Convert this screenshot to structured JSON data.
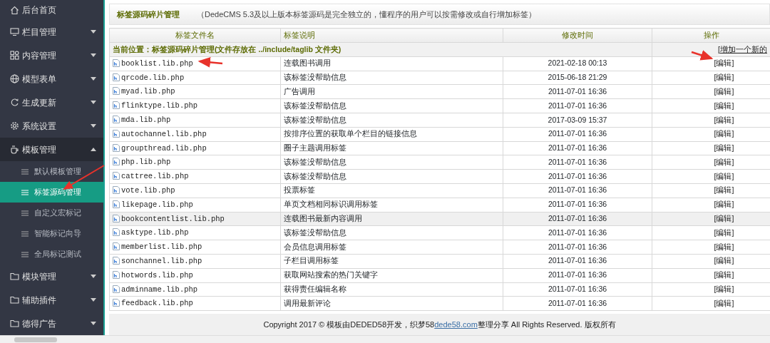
{
  "sidebar": {
    "items": [
      {
        "label": "后台首页",
        "kind": "link",
        "expanded": false
      },
      {
        "label": "栏目管理",
        "kind": "menu",
        "expanded": false
      },
      {
        "label": "内容管理",
        "kind": "menu",
        "expanded": false
      },
      {
        "label": "模型表单",
        "kind": "menu",
        "expanded": false
      },
      {
        "label": "生成更新",
        "kind": "menu",
        "expanded": false
      },
      {
        "label": "系统设置",
        "kind": "menu",
        "expanded": false
      },
      {
        "label": "模板管理",
        "kind": "menu",
        "expanded": true,
        "children": [
          {
            "label": "默认模板管理",
            "selected": false
          },
          {
            "label": "标签源码管理",
            "selected": true
          },
          {
            "label": "自定义宏标记",
            "selected": false
          },
          {
            "label": "智能标记向导",
            "selected": false
          },
          {
            "label": "全局标记测试",
            "selected": false
          }
        ]
      },
      {
        "label": "模块管理",
        "kind": "menu",
        "expanded": false
      },
      {
        "label": "辅助插件",
        "kind": "menu",
        "expanded": false
      },
      {
        "label": "德得广告",
        "kind": "menu",
        "expanded": false
      }
    ]
  },
  "page": {
    "title": "标签源码碎片管理",
    "note": "（DedeCMS 5.3及以上版本标签源码是完全独立的，懂程序的用户可以按需修改或自行增加标签）"
  },
  "table": {
    "columns": [
      "标签文件名",
      "标签说明",
      "修改时间",
      "操作"
    ],
    "location": "当前位置：标签源码碎片管理(文件存放在 ../include/taglib 文件夹)",
    "add_link": "[增加一个新的",
    "rows": [
      {
        "name": "booklist.lib.php",
        "description": "连载图书调用",
        "modified": "2021-02-18 00:13",
        "action": "[编辑]",
        "selected": false
      },
      {
        "name": "qrcode.lib.php",
        "description": "该标签没帮助信息",
        "modified": "2015-06-18 21:29",
        "action": "[编辑]",
        "selected": false
      },
      {
        "name": "myad.lib.php",
        "description": "广告调用",
        "modified": "2011-07-01 16:36",
        "action": "[编辑]",
        "selected": false
      },
      {
        "name": "flinktype.lib.php",
        "description": "该标签没帮助信息",
        "modified": "2011-07-01 16:36",
        "action": "[编辑]",
        "selected": false
      },
      {
        "name": "mda.lib.php",
        "description": "该标签没帮助信息",
        "modified": "2017-03-09 15:37",
        "action": "[编辑]",
        "selected": false
      },
      {
        "name": "autochannel.lib.php",
        "description": "按排序位置的获取单个栏目的链接信息",
        "modified": "2011-07-01 16:36",
        "action": "[编辑]",
        "selected": false
      },
      {
        "name": "groupthread.lib.php",
        "description": "圈子主题调用标签",
        "modified": "2011-07-01 16:36",
        "action": "[编辑]",
        "selected": false
      },
      {
        "name": "php.lib.php",
        "description": "该标签没帮助信息",
        "modified": "2011-07-01 16:36",
        "action": "[编辑]",
        "selected": false
      },
      {
        "name": "cattree.lib.php",
        "description": "该标签没帮助信息",
        "modified": "2011-07-01 16:36",
        "action": "[编辑]",
        "selected": false
      },
      {
        "name": "vote.lib.php",
        "description": "投票标签",
        "modified": "2011-07-01 16:36",
        "action": "[编辑]",
        "selected": false
      },
      {
        "name": "likepage.lib.php",
        "description": "单页文档相同标识调用标签",
        "modified": "2011-07-01 16:36",
        "action": "[编辑]",
        "selected": false
      },
      {
        "name": "bookcontentlist.lib.php",
        "description": "连载图书最新内容调用",
        "modified": "2011-07-01 16:36",
        "action": "[编辑]",
        "selected": true
      },
      {
        "name": "asktype.lib.php",
        "description": "该标签没帮助信息",
        "modified": "2011-07-01 16:36",
        "action": "[编辑]",
        "selected": false
      },
      {
        "name": "memberlist.lib.php",
        "description": "会员信息调用标签",
        "modified": "2011-07-01 16:36",
        "action": "[编辑]",
        "selected": false
      },
      {
        "name": "sonchannel.lib.php",
        "description": "子栏目调用标签",
        "modified": "2011-07-01 16:36",
        "action": "[编辑]",
        "selected": false
      },
      {
        "name": "hotwords.lib.php",
        "description": "获取网站搜索的热门关键字",
        "modified": "2011-07-01 16:36",
        "action": "[编辑]",
        "selected": false
      },
      {
        "name": "adminname.lib.php",
        "description": "获得责任编辑名称",
        "modified": "2011-07-01 16:36",
        "action": "[编辑]",
        "selected": false
      },
      {
        "name": "feedback.lib.php",
        "description": "调用最新评论",
        "modified": "2011-07-01 16:36",
        "action": "[编辑]",
        "selected": false
      }
    ]
  },
  "footer": {
    "before": "Copyright 2017 © 模板由DEDED58开发，织梦58",
    "link": "dede58.com",
    "after": "整理分享 All Rights Reserved. 版权所有"
  }
}
